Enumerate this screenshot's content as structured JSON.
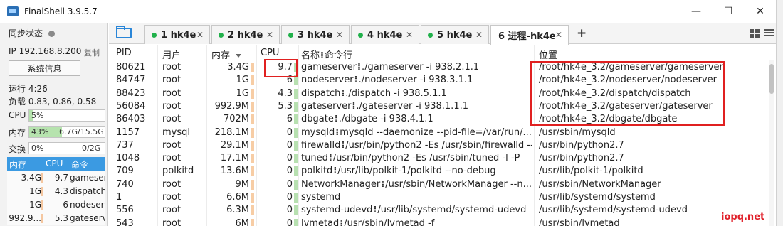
{
  "window": {
    "title": "FinalShell 3.9.5.7",
    "min_glyph": "—",
    "max_glyph": "☐",
    "close_glyph": "✕"
  },
  "sidebar": {
    "sync_status": "同步状态",
    "ip": "IP 192.168.8.200",
    "copy": "复制",
    "sysinfo_button": "系统信息",
    "uptime": "运行 4:26",
    "load": "负载 0.83, 0.86, 0.58",
    "cpu": {
      "label": "CPU",
      "value": "5%",
      "percent": 5
    },
    "mem": {
      "label": "内存",
      "percent_text": "43%",
      "detail": "6.7G/15.5G",
      "percent": 43
    },
    "swap": {
      "label": "交换",
      "percent_text": "0%",
      "detail": "0/2G",
      "percent": 0
    },
    "proc_header": {
      "mem": "内存",
      "cpu": "CPU",
      "cmd": "命令"
    },
    "proc_rows": [
      {
        "mem": "3.4G",
        "cpu": "9.7",
        "cmd": "gameserver"
      },
      {
        "mem": "1G",
        "cpu": "4.3",
        "cmd": "dispatch"
      },
      {
        "mem": "1G",
        "cpu": "6",
        "cmd": "nodeserver"
      },
      {
        "mem": "992.9...",
        "cpu": "5.3",
        "cmd": "gateserver"
      }
    ]
  },
  "tabs": [
    {
      "label": "1 hk4e",
      "status": "connected"
    },
    {
      "label": "2 hk4e",
      "status": "connected"
    },
    {
      "label": "3 hk4e",
      "status": "connected"
    },
    {
      "label": "4 hk4e",
      "status": "connected"
    },
    {
      "label": "5 hk4e",
      "status": "connected"
    },
    {
      "label": "6 进程-hk4e",
      "status": "active"
    }
  ],
  "tab_close_glyph": "✕",
  "add_tab_glyph": "+",
  "columns": {
    "pid": "PID",
    "user": "用户",
    "mem": "内存",
    "cpu": "CPU",
    "name_cmd": "名称",
    "cmd": "命令行",
    "location": "位置"
  },
  "processes": [
    {
      "pid": "80621",
      "user": "root",
      "mem": "3.4G",
      "cpu": "9.7",
      "name": "gameserver",
      "cmd": "./gameserver -i 938.2.1.1",
      "loc": "/root/hk4e_3.2/gameserver/gameserver"
    },
    {
      "pid": "84747",
      "user": "root",
      "mem": "1G",
      "cpu": "6",
      "name": "nodeserver",
      "cmd": "./nodeserver -i 938.3.1.1",
      "loc": "/root/hk4e_3.2/nodeserver/nodeserver"
    },
    {
      "pid": "88423",
      "user": "root",
      "mem": "1G",
      "cpu": "4.3",
      "name": "dispatch",
      "cmd": "./dispatch -i 938.5.1.1",
      "loc": "/root/hk4e_3.2/dispatch/dispatch"
    },
    {
      "pid": "56084",
      "user": "root",
      "mem": "992.9M",
      "cpu": "5.3",
      "name": "gateserver",
      "cmd": "./gateserver -i 938.1.1.1",
      "loc": "/root/hk4e_3.2/gateserver/gateserver"
    },
    {
      "pid": "86403",
      "user": "root",
      "mem": "702M",
      "cpu": "6",
      "name": "dbgate",
      "cmd": "./dbgate -i 938.4.1.1",
      "loc": "/root/hk4e_3.2/dbgate/dbgate"
    },
    {
      "pid": "1157",
      "user": "mysql",
      "mem": "218.1M",
      "cpu": "0",
      "name": "mysqld",
      "cmd": "mysqld  --daemonize --pid-file=/var/run/...",
      "loc": "/usr/sbin/mysqld"
    },
    {
      "pid": "737",
      "user": "root",
      "mem": "29.1M",
      "cpu": "0",
      "name": "firewalld",
      "cmd": "/usr/bin/python2 -Es /usr/sbin/firewalld --...",
      "loc": "/usr/bin/python2.7"
    },
    {
      "pid": "1048",
      "user": "root",
      "mem": "17.1M",
      "cpu": "0",
      "name": "tuned",
      "cmd": "/usr/bin/python2 -Es /usr/sbin/tuned -l -P",
      "loc": "/usr/bin/python2.7"
    },
    {
      "pid": "709",
      "user": "polkitd",
      "mem": "13.6M",
      "cpu": "0",
      "name": "polkitd",
      "cmd": "/usr/lib/polkit-1/polkitd --no-debug",
      "loc": "/usr/lib/polkit-1/polkitd"
    },
    {
      "pid": "740",
      "user": "root",
      "mem": "9M",
      "cpu": "0",
      "name": "NetworkManager",
      "cmd": "/usr/sbin/NetworkManager --n...",
      "loc": "/usr/sbin/NetworkManager"
    },
    {
      "pid": "1",
      "user": "root",
      "mem": "6.6M",
      "cpu": "0",
      "name": "systemd",
      "cmd": "",
      "loc": "/usr/lib/systemd/systemd"
    },
    {
      "pid": "556",
      "user": "root",
      "mem": "6.3M",
      "cpu": "0",
      "name": "systemd-udevd",
      "cmd": "/usr/lib/systemd/systemd-udevd",
      "loc": "/usr/lib/systemd/systemd-udevd"
    },
    {
      "pid": "543",
      "user": "root",
      "mem": "6M",
      "cpu": "0",
      "name": "lvmetad",
      "cmd": "/usr/sbin/lvmetad -f",
      "loc": "/usr/sbin/lvmetad"
    }
  ],
  "name_cmd_separator": "⁞",
  "watermark": "iopq.net"
}
